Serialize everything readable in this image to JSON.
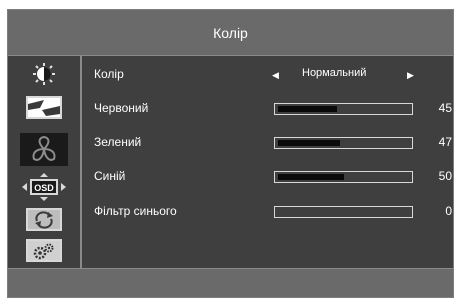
{
  "osd": {
    "title": "Колір",
    "sidebar": [
      {
        "icon": "brightness-contrast-icon",
        "selected": false
      },
      {
        "icon": "image-icon",
        "selected": false
      },
      {
        "icon": "color-wheel-icon",
        "selected": true
      },
      {
        "icon": "osd-settings-icon",
        "label": "OSD",
        "selected": false
      },
      {
        "icon": "reset-icon",
        "selected": false
      },
      {
        "icon": "system-settings-icon",
        "selected": false
      }
    ],
    "items": {
      "color_mode": {
        "label": "Колір",
        "value": "Нормальний"
      },
      "red": {
        "label": "Червоний",
        "value": "45"
      },
      "green": {
        "label": "Зелений",
        "value": "47"
      },
      "blue": {
        "label": "Синій",
        "value": "50"
      },
      "blue_filter": {
        "label": "Фільтр синього",
        "value": "0"
      }
    },
    "colors": {
      "panel": "#3f3f3f",
      "title_bar": "#6a6a6a",
      "bar_fill": "#0a0a0a"
    }
  }
}
